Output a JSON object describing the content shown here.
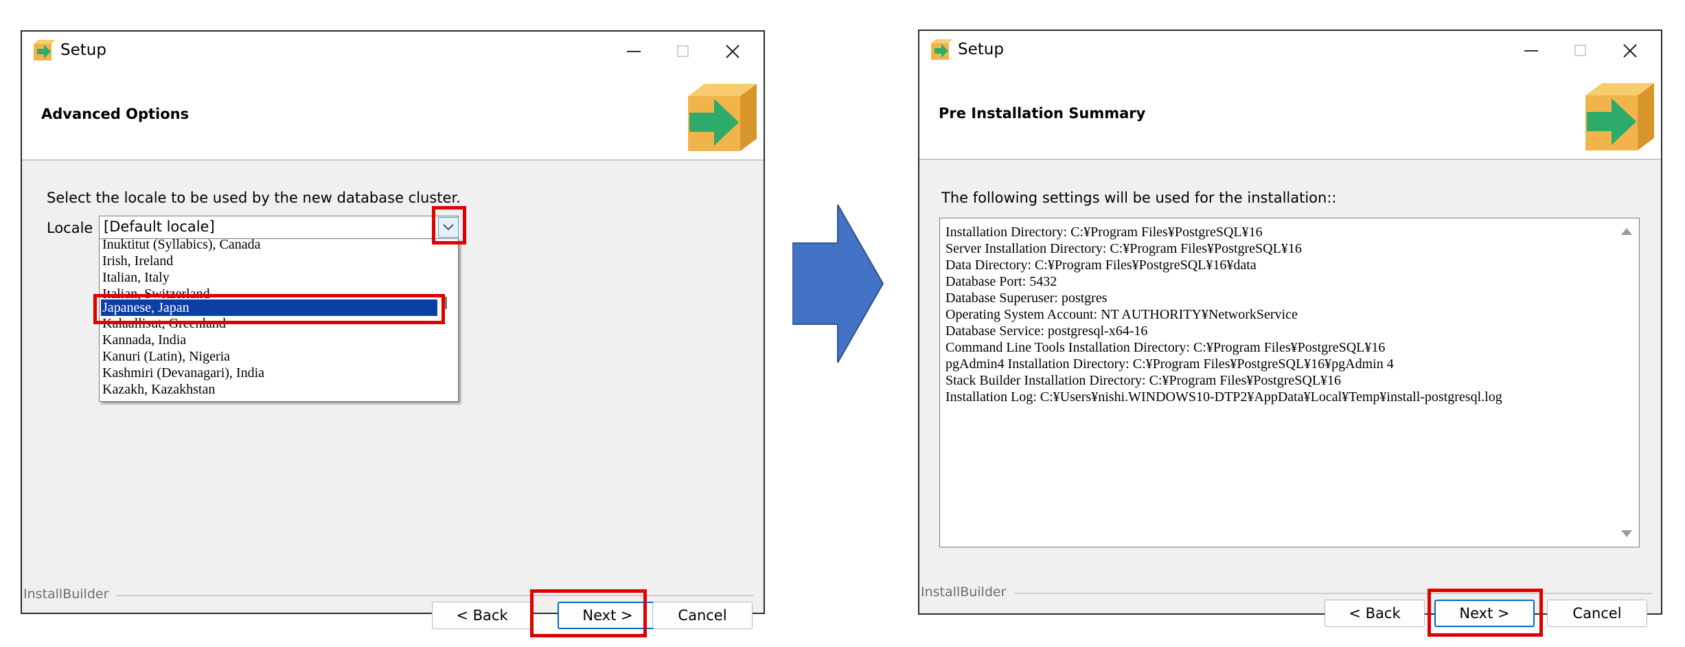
{
  "colors": {
    "highlight_red": "#e00000",
    "selection_blue": "#0c3ea6",
    "arrow_blue": "#4472c4",
    "primary_button_border": "#0067c0"
  },
  "left_window": {
    "title": "Setup",
    "header_title": "Advanced Options",
    "prompt": "Select the locale to be used by the new database cluster.",
    "locale_label": "Locale",
    "locale_value": "[Default locale]",
    "dropdown_options": [
      "Inuktitut (Syllabics), Canada",
      "Irish, Ireland",
      "Italian, Italy",
      "Italian, Switzerland",
      "Japanese, Japan",
      "Kalaallisut, Greenland",
      "Kannada, India",
      "Kanuri (Latin), Nigeria",
      "Kashmiri (Devanagari), India",
      "Kazakh, Kazakhstan"
    ],
    "selected_option": "Japanese, Japan",
    "footer_label": "InstallBuilder",
    "buttons": {
      "back": "< Back",
      "next": "Next >",
      "cancel": "Cancel"
    }
  },
  "right_window": {
    "title": "Setup",
    "header_title": "Pre Installation Summary",
    "intro": "The following settings will be used for the installation::",
    "summary_lines": [
      "Installation Directory: C:¥Program Files¥PostgreSQL¥16",
      "Server Installation Directory: C:¥Program Files¥PostgreSQL¥16",
      "Data Directory: C:¥Program Files¥PostgreSQL¥16¥data",
      "Database Port: 5432",
      "Database Superuser: postgres",
      "Operating System Account: NT AUTHORITY¥NetworkService",
      "Database Service: postgresql-x64-16",
      "Command Line Tools Installation Directory: C:¥Program Files¥PostgreSQL¥16",
      "pgAdmin4 Installation Directory: C:¥Program Files¥PostgreSQL¥16¥pgAdmin 4",
      "Stack Builder Installation Directory: C:¥Program Files¥PostgreSQL¥16",
      "Installation Log: C:¥Users¥nishi.WINDOWS10-DTP2¥AppData¥Local¥Temp¥install-postgresql.log"
    ],
    "footer_label": "InstallBuilder",
    "buttons": {
      "back": "< Back",
      "next": "Next >",
      "cancel": "Cancel"
    }
  }
}
